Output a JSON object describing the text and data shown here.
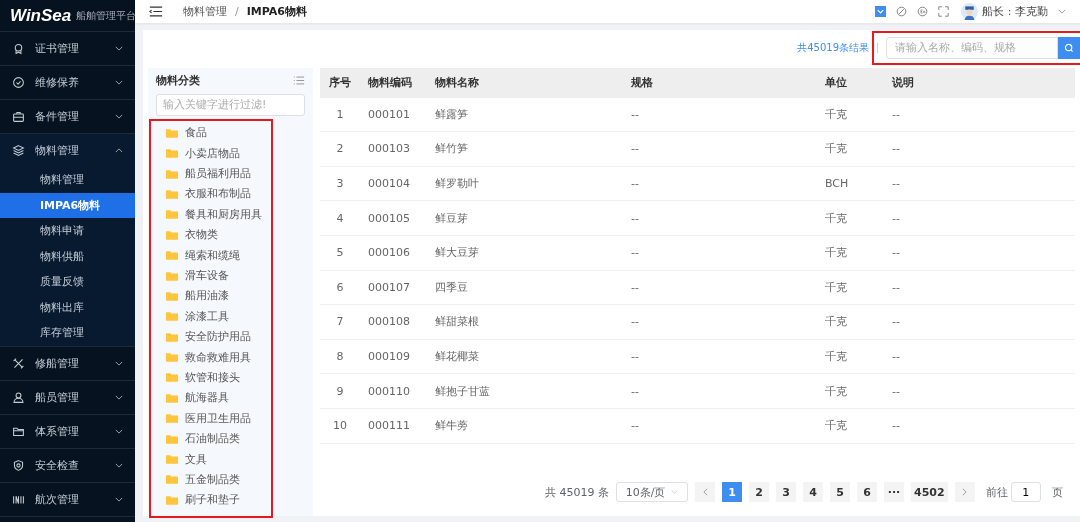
{
  "brand": {
    "logo": "WinSea",
    "subtitle": "船舶管理平台"
  },
  "sidebar": {
    "items": [
      {
        "label": "证书管理",
        "expanded": false,
        "selected": false
      },
      {
        "label": "维修保养",
        "expanded": false,
        "selected": false
      },
      {
        "label": "备件管理",
        "expanded": false,
        "selected": false
      },
      {
        "label": "物料管理",
        "expanded": true,
        "selected": false,
        "children": [
          {
            "label": "物料管理",
            "selected": false
          },
          {
            "label": "IMPA6物料",
            "selected": true
          },
          {
            "label": "物料申请",
            "selected": false
          },
          {
            "label": "物料供船",
            "selected": false
          },
          {
            "label": "质量反馈",
            "selected": false
          },
          {
            "label": "物料出库",
            "selected": false
          },
          {
            "label": "库存管理",
            "selected": false
          }
        ]
      },
      {
        "label": "修船管理",
        "expanded": false,
        "selected": false
      },
      {
        "label": "船员管理",
        "expanded": false,
        "selected": false
      },
      {
        "label": "体系管理",
        "expanded": false,
        "selected": false
      },
      {
        "label": "安全检查",
        "expanded": false,
        "selected": false
      },
      {
        "label": "航次管理",
        "expanded": false,
        "selected": false
      }
    ]
  },
  "breadcrumb": {
    "items": [
      "物料管理",
      "IMPA6物料"
    ],
    "separator": "/"
  },
  "user": {
    "name": "船长 : 李克勤"
  },
  "result_count": "共45019条结果",
  "search": {
    "placeholder": "请输入名称、编码、规格"
  },
  "category_panel": {
    "title": "物料分类",
    "filter_placeholder": "输入关键字进行过滤!",
    "items": [
      "食品",
      "小卖店物品",
      "船员福利用品",
      "衣服和布制品",
      "餐具和厨房用具",
      "衣物类",
      "绳索和缆绳",
      "滑车设备",
      "船用油漆",
      "涂漆工具",
      "安全防护用品",
      "救命救难用具",
      "软管和接头",
      "航海器具",
      "医用卫生用品",
      "石油制品类",
      "文具",
      "五金制品类",
      "刷子和垫子"
    ]
  },
  "table": {
    "columns": [
      "序号",
      "物料编码",
      "物料名称",
      "规格",
      "单位",
      "说明"
    ],
    "rows": [
      [
        "1",
        "000101",
        "鲜露笋",
        "--",
        "千克",
        "--"
      ],
      [
        "2",
        "000103",
        "鲜竹笋",
        "--",
        "千克",
        "--"
      ],
      [
        "3",
        "000104",
        "鲜罗勒叶",
        "--",
        "BCH",
        "--"
      ],
      [
        "4",
        "000105",
        "鲜豆芽",
        "--",
        "千克",
        "--"
      ],
      [
        "5",
        "000106",
        "鲜大豆芽",
        "--",
        "千克",
        "--"
      ],
      [
        "6",
        "000107",
        "四季豆",
        "--",
        "千克",
        "--"
      ],
      [
        "7",
        "000108",
        "鲜甜菜根",
        "--",
        "千克",
        "--"
      ],
      [
        "8",
        "000109",
        "鲜花椰菜",
        "--",
        "千克",
        "--"
      ],
      [
        "9",
        "000110",
        "鲜抱子甘蓝",
        "--",
        "千克",
        "--"
      ],
      [
        "10",
        "000111",
        "鲜牛蒡",
        "--",
        "千克",
        "--"
      ]
    ]
  },
  "pagination": {
    "total": "共 45019 条",
    "page_size": "10条/页",
    "pages": [
      {
        "label": "1",
        "selected": true
      },
      {
        "label": "2",
        "selected": false
      },
      {
        "label": "3",
        "selected": false
      },
      {
        "label": "4",
        "selected": false
      },
      {
        "label": "5",
        "selected": false
      },
      {
        "label": "6",
        "selected": false
      },
      {
        "label": "···",
        "selected": false
      },
      {
        "label": "4502",
        "selected": false
      }
    ],
    "goto_label": "前往",
    "goto_value": "1",
    "page_suffix": "页"
  }
}
